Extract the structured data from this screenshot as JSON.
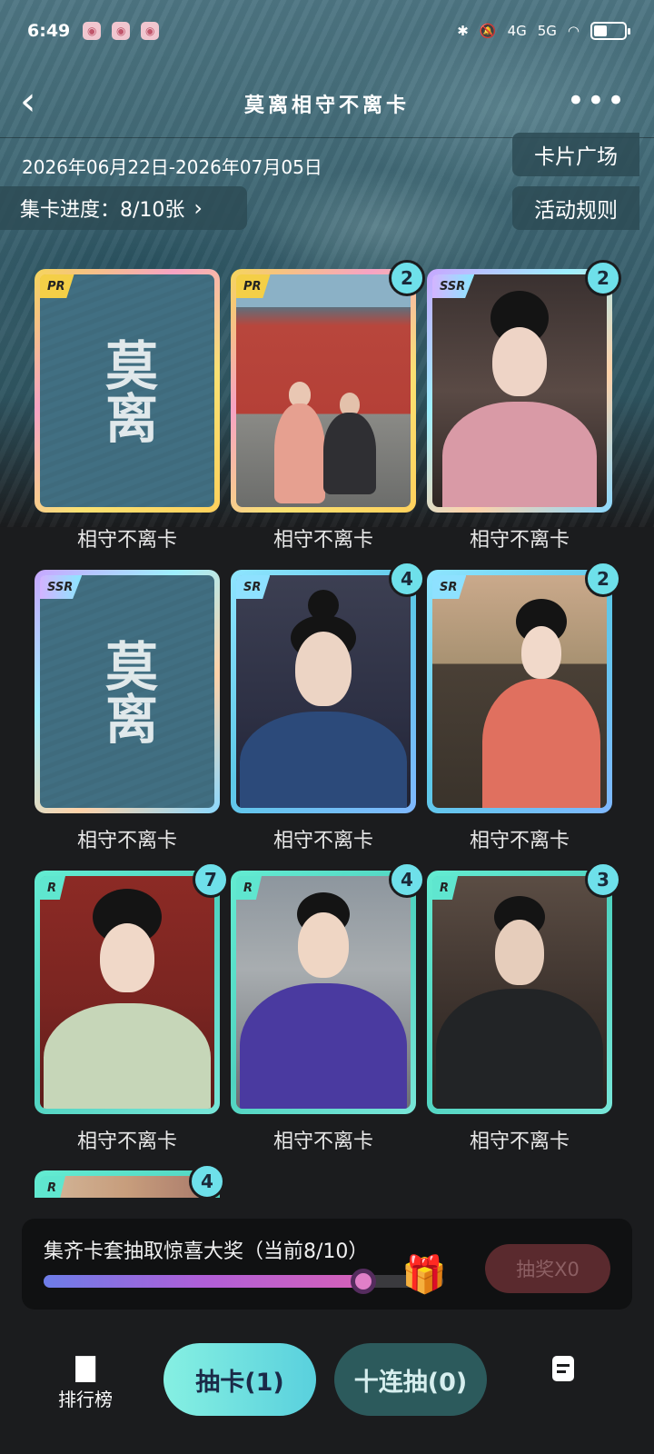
{
  "status_bar": {
    "time": "6:49",
    "network": "4G",
    "network2": "5G"
  },
  "header": {
    "title": "莫离相守不离卡",
    "more_icon": "more-dots-icon"
  },
  "info": {
    "date_range": "2026年06月22日-2026年07月05日",
    "progress_label": "集卡进度：8/10张",
    "card_square_label": "卡片广场",
    "rules_label": "活动规则"
  },
  "cards": [
    {
      "rarity": "PR",
      "name": "相守不离卡",
      "count": "",
      "art": "logo"
    },
    {
      "rarity": "PR",
      "name": "相守不离卡",
      "count": "2",
      "art": "palace"
    },
    {
      "rarity": "SSR",
      "name": "相守不离卡",
      "count": "2",
      "art": "pink"
    },
    {
      "rarity": "SSR",
      "name": "相守不离卡",
      "count": "",
      "art": "logo"
    },
    {
      "rarity": "SR",
      "name": "相守不离卡",
      "count": "4",
      "art": "man-blue"
    },
    {
      "rarity": "SR",
      "name": "相守不离卡",
      "count": "2",
      "art": "red-lady"
    },
    {
      "rarity": "R",
      "name": "相守不离卡",
      "count": "7",
      "art": "green-lady"
    },
    {
      "rarity": "R",
      "name": "相守不离卡",
      "count": "4",
      "art": "purple"
    },
    {
      "rarity": "R",
      "name": "相守不离卡",
      "count": "3",
      "art": "dark"
    }
  ],
  "logo_text": "莫离",
  "partial_card": {
    "rarity": "R",
    "count": "4"
  },
  "reward": {
    "text": "集齐卡套抽取惊喜大奖（当前8/10）",
    "progress_fraction": 0.8,
    "lottery_label": "抽奖X0"
  },
  "bottom": {
    "rank_label": "排行榜",
    "draw_label": "抽卡(1)",
    "ten_draw_label": "十连抽(0)"
  },
  "colors": {
    "accent": "#6ee0ea",
    "pr": "#f4cf47",
    "r": "#5fe6cf"
  }
}
